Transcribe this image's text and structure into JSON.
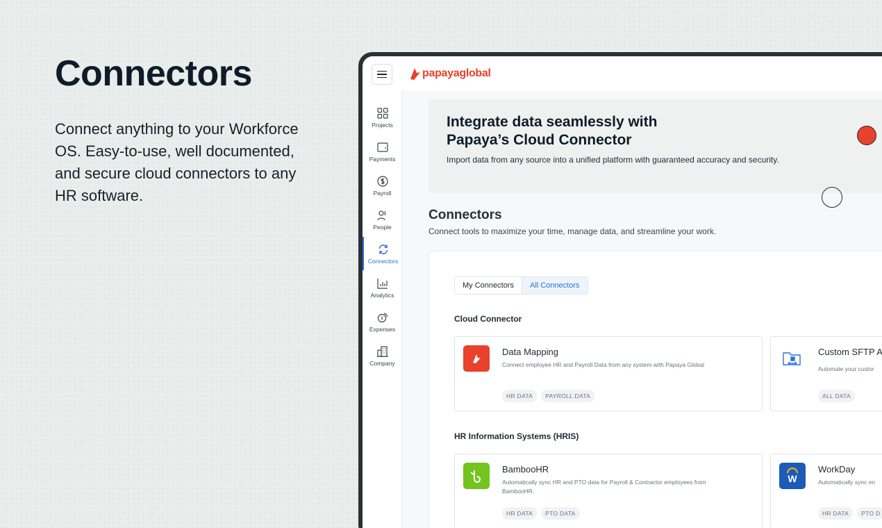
{
  "hero": {
    "title": "Connectors",
    "description": "Connect anything to your Workforce OS. Easy-to-use, well documented, and secure cloud connectors to any HR software."
  },
  "app": {
    "logo_text": "papayaglobal",
    "brand_color": "#e8412c",
    "accent_color": "#2a6fdb"
  },
  "sidebar": {
    "items": [
      {
        "label": "Projects",
        "icon": "grid-icon",
        "active": false
      },
      {
        "label": "Payments",
        "icon": "wallet-icon",
        "active": false
      },
      {
        "label": "Payroll",
        "icon": "dollar-circle-icon",
        "active": false
      },
      {
        "label": "People",
        "icon": "people-icon",
        "active": false
      },
      {
        "label": "Connectors",
        "icon": "sync-icon",
        "active": true
      },
      {
        "label": "Analytics",
        "icon": "bar-chart-icon",
        "active": false
      },
      {
        "label": "Expenses",
        "icon": "coin-icon",
        "active": false
      },
      {
        "label": "Company",
        "icon": "building-icon",
        "active": false
      }
    ]
  },
  "banner": {
    "title": "Integrate data seamlessly with Papaya’s Cloud Connector",
    "subtitle": "Import data from any source into a unified platform with guaranteed accuracy and security."
  },
  "connectors": {
    "title": "Connectors",
    "subtitle": "Connect tools to maximize your time, manage data, and streamline your work.",
    "tabs": [
      {
        "label": "My Connectors",
        "selected": false
      },
      {
        "label": "All Connectors",
        "selected": true
      }
    ],
    "groups": [
      {
        "title": "Cloud Connector",
        "cards": [
          {
            "title": "Data Mapping",
            "description": "Connect employee HR and Payroll Data from any system with Papaya Global",
            "badges": [
              "HR DATA",
              "PAYROLL DATA"
            ]
          },
          {
            "title": "Custom SFTP Au",
            "description": "Automate your custor",
            "badges": [
              "ALL DATA"
            ]
          }
        ]
      },
      {
        "title": "HR Information Systems (HRIS)",
        "cards": [
          {
            "title": "BambooHR",
            "description": "Automatically sync HR and PTO data for Payroll & Contractor employees from BambooHR.",
            "badges": [
              "HR DATA",
              "PTO DATA"
            ]
          },
          {
            "title": "WorkDay",
            "description": "Automatically sync en",
            "badges": [
              "HR DATA",
              "PTO D"
            ]
          }
        ]
      }
    ]
  }
}
